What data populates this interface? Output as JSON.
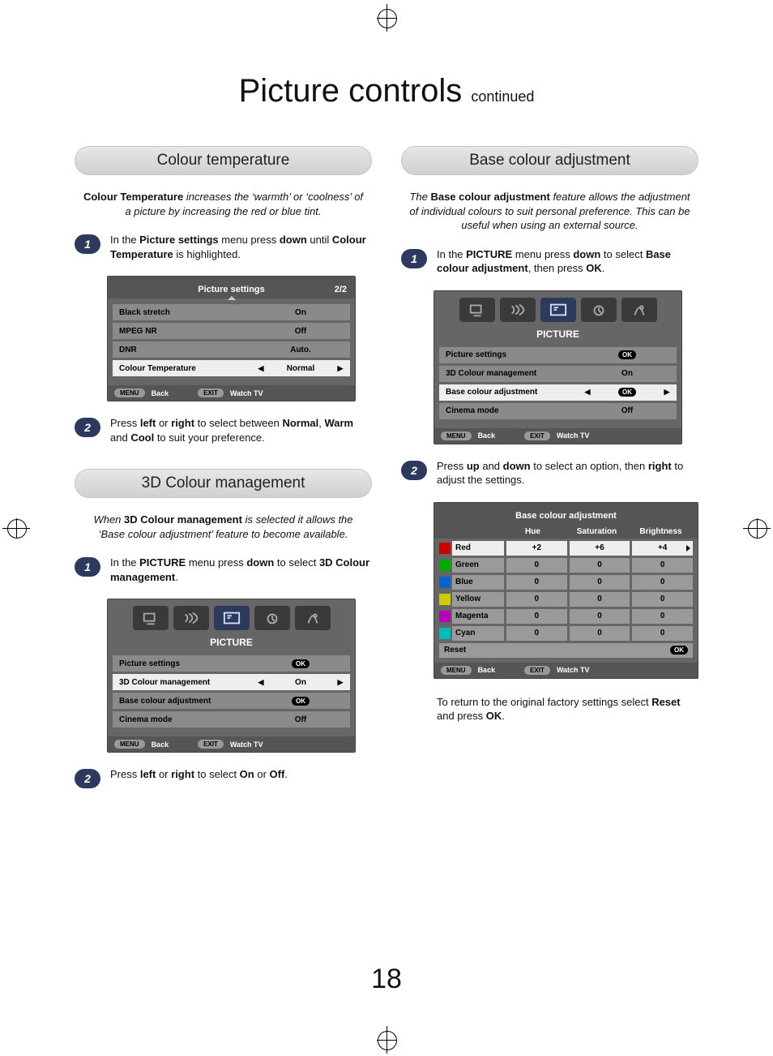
{
  "page_number": "18",
  "title_main": "Picture controls ",
  "title_sub": "continued",
  "left": {
    "section1_heading": "Colour temperature",
    "section1_intro_a": "Colour Temperature",
    "section1_intro_b": " increases the ‘warmth’ or ‘coolness’ of a picture by increasing the red or blue tint.",
    "step1_a": "In the ",
    "step1_b": "Picture settings",
    "step1_c": " menu press ",
    "step1_d": "down",
    "step1_e": " until ",
    "step1_f": "Colour Temperature",
    "step1_g": " is highlighted.",
    "panel1": {
      "title": "Picture settings",
      "page": "2/2",
      "rows": [
        {
          "label": "Black stretch",
          "value": "On",
          "sel": false
        },
        {
          "label": "MPEG NR",
          "value": "Off",
          "sel": false
        },
        {
          "label": "DNR",
          "value": "Auto.",
          "sel": false
        },
        {
          "label": "Colour Temperature",
          "value": "Normal",
          "sel": true
        }
      ],
      "menu": "MENU",
      "back": "Back",
      "exit": "EXIT",
      "watch": "Watch TV"
    },
    "step2_a": "Press ",
    "step2_b": "left",
    "step2_c": " or ",
    "step2_d": "right",
    "step2_e": " to select between ",
    "step2_f": "Normal",
    "step2_g": ", ",
    "step2_h": "Warm",
    "step2_i": " and ",
    "step2_j": "Cool",
    "step2_k": " to suit your preference.",
    "section2_heading": "3D Colour management",
    "section2_intro_a": "When ",
    "section2_intro_b": "3D Colour management",
    "section2_intro_c": " is selected it allows the ‘Base colour adjustment’ feature to become available.",
    "s2step1_a": "In the ",
    "s2step1_b": "PICTURE",
    "s2step1_c": " menu press ",
    "s2step1_d": "down",
    "s2step1_e": " to select ",
    "s2step1_f": "3D Colour management",
    "s2step1_g": ".",
    "panel2": {
      "title": "PICTURE",
      "rows": [
        {
          "label": "Picture settings",
          "value": "OK",
          "sel": false,
          "ok": true
        },
        {
          "label": "3D Colour management",
          "value": "On",
          "sel": true
        },
        {
          "label": "Base colour adjustment",
          "value": "OK",
          "sel": false,
          "ok": true
        },
        {
          "label": "Cinema mode",
          "value": "Off",
          "sel": false
        }
      ],
      "menu": "MENU",
      "back": "Back",
      "exit": "EXIT",
      "watch": "Watch TV"
    },
    "s2step2_a": "Press ",
    "s2step2_b": "left",
    "s2step2_c": " or ",
    "s2step2_d": "right",
    "s2step2_e": " to select ",
    "s2step2_f": "On",
    "s2step2_g": " or ",
    "s2step2_h": "Off",
    "s2step2_i": "."
  },
  "right": {
    "section1_heading": "Base colour adjustment",
    "section1_intro_a": "The ",
    "section1_intro_b": "Base colour adjustment",
    "section1_intro_c": " feature allows the adjustment of individual colours to suit personal preference. This can be useful when using an external source.",
    "step1_a": "In the ",
    "step1_b": "PICTURE",
    "step1_c": " menu press ",
    "step1_d": "down",
    "step1_e": " to select ",
    "step1_f": "Base colour adjustment",
    "step1_g": ", then press ",
    "step1_h": "OK",
    "step1_i": ".",
    "panel1": {
      "title": "PICTURE",
      "rows": [
        {
          "label": "Picture settings",
          "value": "OK",
          "sel": false,
          "ok": true
        },
        {
          "label": "3D Colour management",
          "value": "On",
          "sel": false
        },
        {
          "label": "Base colour adjustment",
          "value": "OK",
          "sel": true,
          "ok": true
        },
        {
          "label": "Cinema mode",
          "value": "Off",
          "sel": false
        }
      ],
      "menu": "MENU",
      "back": "Back",
      "exit": "EXIT",
      "watch": "Watch TV"
    },
    "step2_a": "Press ",
    "step2_b": "up",
    "step2_c": " and ",
    "step2_d": "down",
    "step2_e": " to select an option, then ",
    "step2_f": "right",
    "step2_g": " to adjust the settings.",
    "panel2": {
      "title": "Base colour adjustment",
      "cols": [
        "Hue",
        "Saturation",
        "Brightness"
      ],
      "rows": [
        {
          "name": "Red",
          "sw": "sw-red",
          "vals": [
            "+2",
            "+6",
            "+4"
          ],
          "sel": true
        },
        {
          "name": "Green",
          "sw": "sw-green",
          "vals": [
            "0",
            "0",
            "0"
          ]
        },
        {
          "name": "Blue",
          "sw": "sw-blue",
          "vals": [
            "0",
            "0",
            "0"
          ]
        },
        {
          "name": "Yellow",
          "sw": "sw-yellow",
          "vals": [
            "0",
            "0",
            "0"
          ]
        },
        {
          "name": "Magenta",
          "sw": "sw-magenta",
          "vals": [
            "0",
            "0",
            "0"
          ]
        },
        {
          "name": "Cyan",
          "sw": "sw-cyan",
          "vals": [
            "0",
            "0",
            "0"
          ]
        }
      ],
      "reset": "Reset",
      "ok": "OK",
      "menu": "MENU",
      "back": "Back",
      "exit": "EXIT",
      "watch": "Watch TV"
    },
    "out_a": "To return to the original factory settings select ",
    "out_b": "Reset",
    "out_c": " and press ",
    "out_d": "OK",
    "out_e": "."
  }
}
